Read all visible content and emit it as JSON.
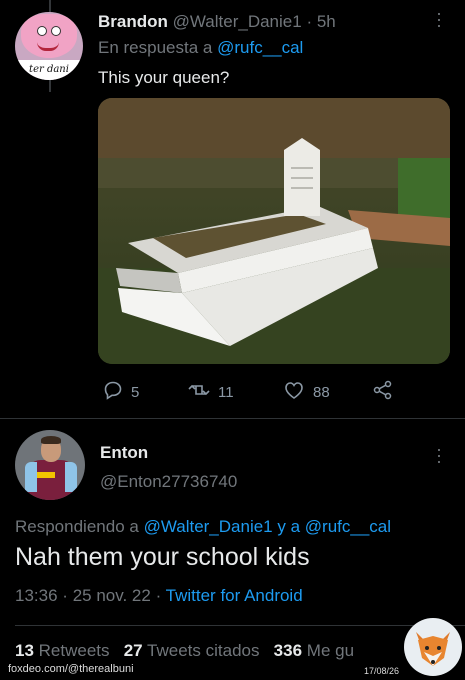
{
  "reply_tweet": {
    "display_name": "Brandon",
    "handle": "@Walter_Danie1",
    "separator": "·",
    "time_ago": "5h",
    "in_reply_prefix": "En respuesta a",
    "in_reply_handle": "@rufc__cal",
    "text": "This your queen?",
    "avatar_caption": "ter dani",
    "image_alt": "grave",
    "actions": {
      "replies": "5",
      "retweets": "11",
      "likes": "88"
    }
  },
  "main_tweet": {
    "display_name": "Enton",
    "handle": "@Enton27736740",
    "replying_prefix": "Respondiendo a",
    "replying_handle_1": "@Walter_Danie1",
    "replying_conjunction": "y a",
    "replying_handle_2": "@rufc__cal",
    "text": "Nah them your school kids",
    "time": "13:36",
    "date": "25 nov. 22",
    "meta_sep": "·",
    "source": "Twitter for Android",
    "stats": {
      "retweets_count": "13",
      "retweets_label": "Retweets",
      "quotes_count": "27",
      "quotes_label": "Tweets citados",
      "likes_count": "336",
      "likes_label": "Me gu"
    }
  },
  "watermark": {
    "site": "foxdeo.com/@therealbuni",
    "date": "17/08/26"
  },
  "colors": {
    "background": "#000000",
    "text": "#e7e9ea",
    "muted": "#71767b",
    "link": "#1d9bf0",
    "divider": "#2f3336"
  }
}
